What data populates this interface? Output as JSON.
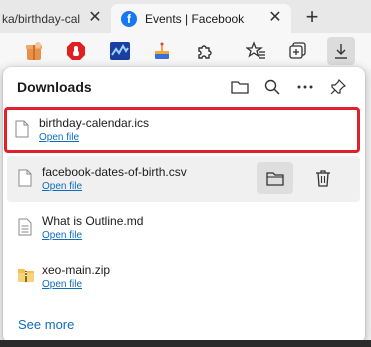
{
  "tabs": [
    {
      "title": "ka/birthday-cal",
      "active": false
    },
    {
      "title": "Events | Facebook",
      "active": true
    }
  ],
  "tab_close_glyph": "✕",
  "new_tab_glyph": "+",
  "favicon_letter": "f",
  "toolbar_icons": [
    "gift-extension-icon",
    "adblock-stop-icon",
    "waveform-extension-icon",
    "cake-extension-icon",
    "extensions-puzzle-icon",
    "favorites-icon",
    "collections-icon",
    "downloads-icon"
  ],
  "downloads": {
    "title": "Downloads",
    "see_more": "See more",
    "items": [
      {
        "name": "birthday-calendar.ics",
        "action": "Open file",
        "icon": "file-icon",
        "highlighted": true
      },
      {
        "name": "facebook-dates-of-birth.csv",
        "action": "Open file",
        "icon": "file-icon",
        "hovered": true
      },
      {
        "name": "What is Outline.md",
        "action": "Open file",
        "icon": "document-icon"
      },
      {
        "name": "xeo-main.zip",
        "action": "Open file",
        "icon": "zip-folder-icon"
      }
    ]
  },
  "colors": {
    "accent": "#0f6cbd",
    "highlight_border": "#e0202b",
    "facebook_blue": "#1877f2"
  }
}
